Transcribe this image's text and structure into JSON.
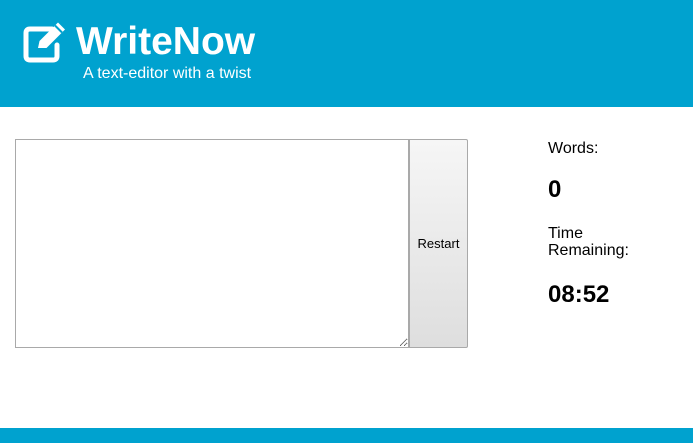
{
  "header": {
    "title": "WriteNow",
    "subtitle": "A text-editor with a twist",
    "logo_icon": "edit-icon",
    "background_color": "#00a2cf"
  },
  "editor": {
    "value": "",
    "placeholder": ""
  },
  "restart_button": {
    "label": "Restart"
  },
  "stats": {
    "words_label": "Words:",
    "words_value": "0",
    "time_label": "Time Remaining:",
    "time_value": "08:52"
  }
}
